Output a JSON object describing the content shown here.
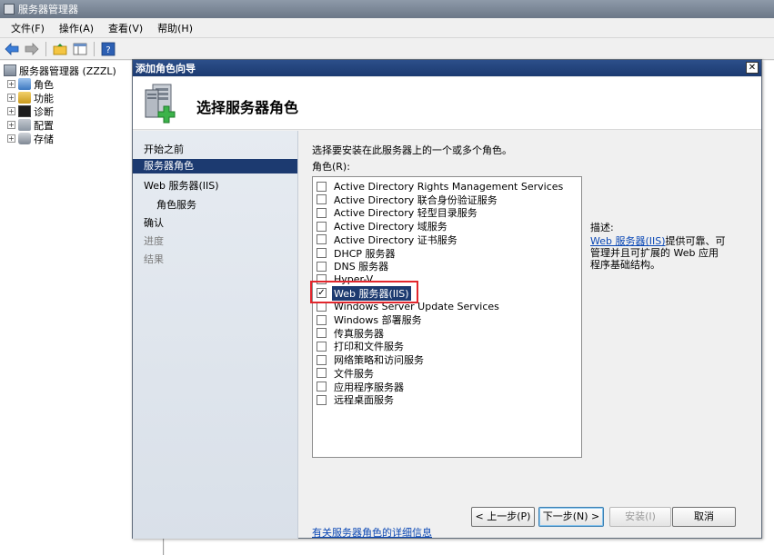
{
  "window": {
    "title": "服务器管理器"
  },
  "menu": [
    "文件(F)",
    "操作(A)",
    "查看(V)",
    "帮助(H)"
  ],
  "toolbar": {
    "icons": [
      "back-icon",
      "forward-icon",
      "up-folder-icon",
      "show-hide-tree-icon",
      "help-icon"
    ]
  },
  "tree": {
    "root": "服务器管理器 (ZZZL)",
    "items": [
      "角色",
      "功能",
      "诊断",
      "配置",
      "存储"
    ]
  },
  "dialog": {
    "title": "添加角色向导",
    "header_title": "选择服务器角色",
    "steps": [
      "开始之前",
      "服务器角色",
      "Web 服务器(IIS)",
      "角色服务",
      "确认",
      "进度",
      "结果"
    ],
    "current_step": 1,
    "instruction": "选择要安装在此服务器上的一个或多个角色。",
    "roles_label": "角色(R):",
    "roles": [
      {
        "label": "Active Directory Rights Management Services",
        "checked": false
      },
      {
        "label": "Active Directory 联合身份验证服务",
        "checked": false
      },
      {
        "label": "Active Directory 轻型目录服务",
        "checked": false
      },
      {
        "label": "Active Directory 域服务",
        "checked": false
      },
      {
        "label": "Active Directory 证书服务",
        "checked": false
      },
      {
        "label": "DHCP 服务器",
        "checked": false
      },
      {
        "label": "DNS 服务器",
        "checked": false
      },
      {
        "label": "Hyper-V",
        "checked": false
      },
      {
        "label": "Web 服务器(IIS)",
        "checked": true
      },
      {
        "label": "Windows Server Update Services",
        "checked": false
      },
      {
        "label": "Windows 部署服务",
        "checked": false
      },
      {
        "label": "传真服务器",
        "checked": false
      },
      {
        "label": "打印和文件服务",
        "checked": false
      },
      {
        "label": "网络策略和访问服务",
        "checked": false
      },
      {
        "label": "文件服务",
        "checked": false
      },
      {
        "label": "应用程序服务器",
        "checked": false
      },
      {
        "label": "远程桌面服务",
        "checked": false
      }
    ],
    "description_title": "描述:",
    "description_link": "Web 服务器(IIS)",
    "description_text": "提供可靠、可管理并且可扩展的 Web 应用程序基础结构。",
    "more_info_link": "有关服务器角色的详细信息",
    "buttons": {
      "previous": "< 上一步(P)",
      "next": "下一步(N) >",
      "install": "安装(I)",
      "cancel": "取消"
    }
  }
}
